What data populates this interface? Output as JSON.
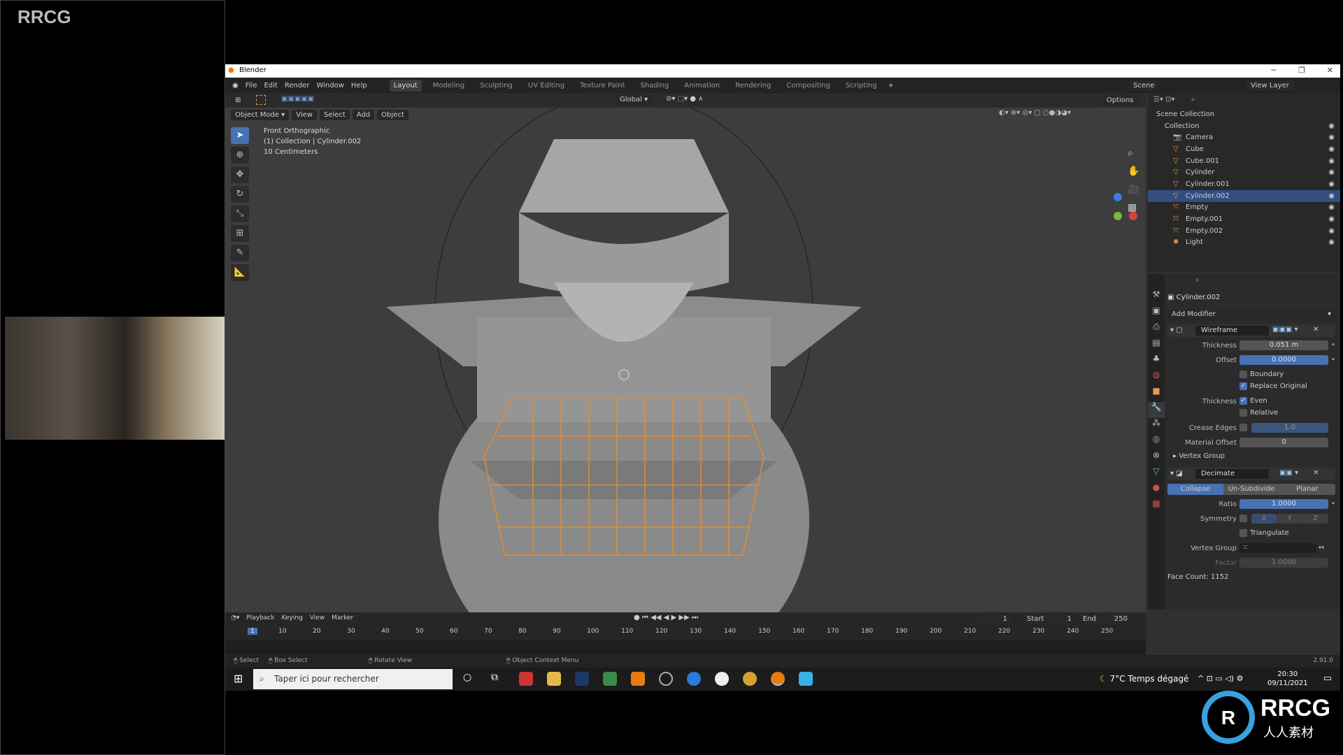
{
  "overlay": {
    "brand": "RRCG",
    "logo_text": "RRCG",
    "logo_sub": "人人素材"
  },
  "window": {
    "title": "Blender"
  },
  "menu": {
    "items": [
      "File",
      "Edit",
      "Render",
      "Window",
      "Help"
    ],
    "workspaces": [
      "Layout",
      "Modeling",
      "Sculpting",
      "UV Editing",
      "Texture Paint",
      "Shading",
      "Animation",
      "Rendering",
      "Compositing",
      "Scripting"
    ],
    "active_workspace": "Layout",
    "scene": "Scene",
    "view_layer": "View Layer"
  },
  "toolheader": {
    "orientation": "Global",
    "options": "Options"
  },
  "viewport": {
    "mode": "Object Mode",
    "menus": [
      "View",
      "Select",
      "Add",
      "Object"
    ],
    "info": [
      "Front Orthographic",
      "(1) Collection | Cylinder.002",
      "10 Centimeters"
    ]
  },
  "outliner": {
    "root": "Scene Collection",
    "collection": "Collection",
    "items": [
      {
        "name": "Camera",
        "type": "camera"
      },
      {
        "name": "Cube",
        "type": "mesh"
      },
      {
        "name": "Cube.001",
        "type": "mesh"
      },
      {
        "name": "Cylinder",
        "type": "mesh"
      },
      {
        "name": "Cylinder.001",
        "type": "mesh"
      },
      {
        "name": "Cylinder.002",
        "type": "mesh",
        "selected": true
      },
      {
        "name": "Empty",
        "type": "empty"
      },
      {
        "name": "Empty.001",
        "type": "empty"
      },
      {
        "name": "Empty.002",
        "type": "empty"
      },
      {
        "name": "Light",
        "type": "light"
      }
    ]
  },
  "properties": {
    "object": "Cylinder.002",
    "add_modifier": "Add Modifier",
    "wireframe": {
      "name": "Wireframe",
      "thickness_label": "Thickness",
      "thickness": "0.051 m",
      "offset_label": "Offset",
      "offset": "0.0000",
      "boundary": "Boundary",
      "boundary_checked": false,
      "replace_original": "Replace Original",
      "replace_checked": true,
      "thickness2_label": "Thickness",
      "even": "Even",
      "even_checked": true,
      "relative": "Relative",
      "relative_checked": false,
      "crease_label": "Crease Edges",
      "crease": "1.0",
      "material_offset_label": "Material Offset",
      "material_offset": "0",
      "vertex_group": "Vertex Group"
    },
    "decimate": {
      "name": "Decimate",
      "modes": [
        "Collapse",
        "Un-Subdivide",
        "Planar"
      ],
      "active_mode": "Collapse",
      "ratio_label": "Ratio",
      "ratio": "1.0000",
      "symmetry_label": "Symmetry",
      "axes": [
        "X",
        "Y",
        "Z"
      ],
      "triangulate": "Triangulate",
      "vertex_group_label": "Vertex Group",
      "factor_label": "Factor",
      "factor": "1.0000",
      "face_count": "Face Count: 1152"
    }
  },
  "timeline": {
    "menus": [
      "Playback",
      "Keying",
      "View",
      "Marker"
    ],
    "current_frame": "1",
    "start_label": "Start",
    "start": "1",
    "end_label": "End",
    "end": "250",
    "ticks": [
      "1",
      "10",
      "20",
      "30",
      "40",
      "50",
      "60",
      "70",
      "80",
      "90",
      "100",
      "110",
      "120",
      "130",
      "140",
      "150",
      "160",
      "170",
      "180",
      "190",
      "200",
      "210",
      "220",
      "230",
      "240",
      "250"
    ]
  },
  "statusbar": {
    "select": "Select",
    "box_select": "Box Select",
    "rotate_view": "Rotate View",
    "context_menu": "Object Context Menu",
    "version": "2.91.0"
  },
  "taskbar": {
    "search_placeholder": "Taper ici pour rechercher",
    "weather": "7°C  Temps dégagé",
    "time": "20:30",
    "date": "09/11/2021"
  }
}
